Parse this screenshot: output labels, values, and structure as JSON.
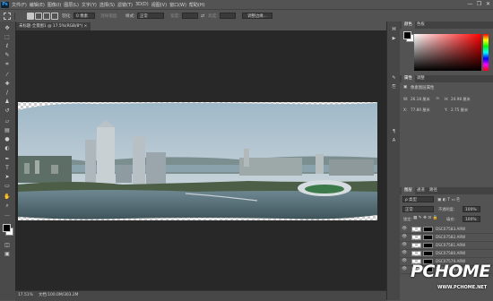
{
  "app": {
    "logo": "Ps"
  },
  "menu": [
    "文件(F)",
    "编辑(E)",
    "图像(I)",
    "图层(L)",
    "文字(Y)",
    "选择(S)",
    "滤镜(T)",
    "3D(D)",
    "视图(V)",
    "窗口(W)",
    "帮助(H)"
  ],
  "window_controls": [
    "—",
    "❐",
    "✕"
  ],
  "options": {
    "feather_label": "羽化:",
    "feather_value": "0 像素",
    "antialias_label": "消除锯齿",
    "style_label": "样式:",
    "style_value": "正常",
    "width_label": "宽度:",
    "height_label": "高度:",
    "refine_label": "调整边缘..."
  },
  "document_tab": {
    "title": "未标题-全景图1 @ 17.5%(RGB/8*)",
    "close": "×"
  },
  "status": {
    "zoom": "17.51%",
    "doc": "文档:100.0M/303.2M"
  },
  "panels": {
    "color_tabs": [
      "颜色",
      "色板"
    ],
    "properties_tabs": [
      "属性",
      "调整"
    ],
    "properties_title": "像素图层属性",
    "prop_w_label": "W:",
    "prop_w": "26.18 厘米",
    "prop_h_label": "H:",
    "prop_h": "24.98 厘米",
    "prop_x_label": "X:",
    "prop_x": "77.80 厘米",
    "prop_y_label": "Y:",
    "prop_y": "2.75 厘米",
    "layers_tabs": [
      "图层",
      "通道",
      "路径"
    ],
    "kind_label": "ρ 类型",
    "blend_mode": "正常",
    "opacity_label": "不透明度:",
    "opacity": "100%",
    "lock_label": "锁定:",
    "fill_label": "填充:",
    "fill": "100%",
    "layers": [
      "DSC07583.ARW",
      "DSC07582.ARW",
      "DSC07581.ARW",
      "DSC07580.ARW",
      "DSC07579.ARW",
      "DSC07578.ARW"
    ]
  },
  "watermark": {
    "brand": "PCHOME",
    "url": "WWW.PCHOME.NET"
  },
  "colors": {
    "foreground": "#000000",
    "background": "#ffffff",
    "picker_hue": "#ff0000",
    "ui_bg": "#535353",
    "canvas_bg": "#282828"
  },
  "icons": {
    "toolbar": [
      "move-icon",
      "marquee-icon",
      "lasso-icon",
      "quick-select-icon",
      "crop-icon",
      "eyedropper-icon",
      "healing-brush-icon",
      "brush-icon",
      "clone-stamp-icon",
      "history-brush-icon",
      "eraser-icon",
      "gradient-icon",
      "blur-icon",
      "dodge-icon",
      "pen-icon",
      "type-icon",
      "path-select-icon",
      "shape-icon",
      "hand-icon",
      "zoom-icon",
      "more-icon"
    ]
  }
}
